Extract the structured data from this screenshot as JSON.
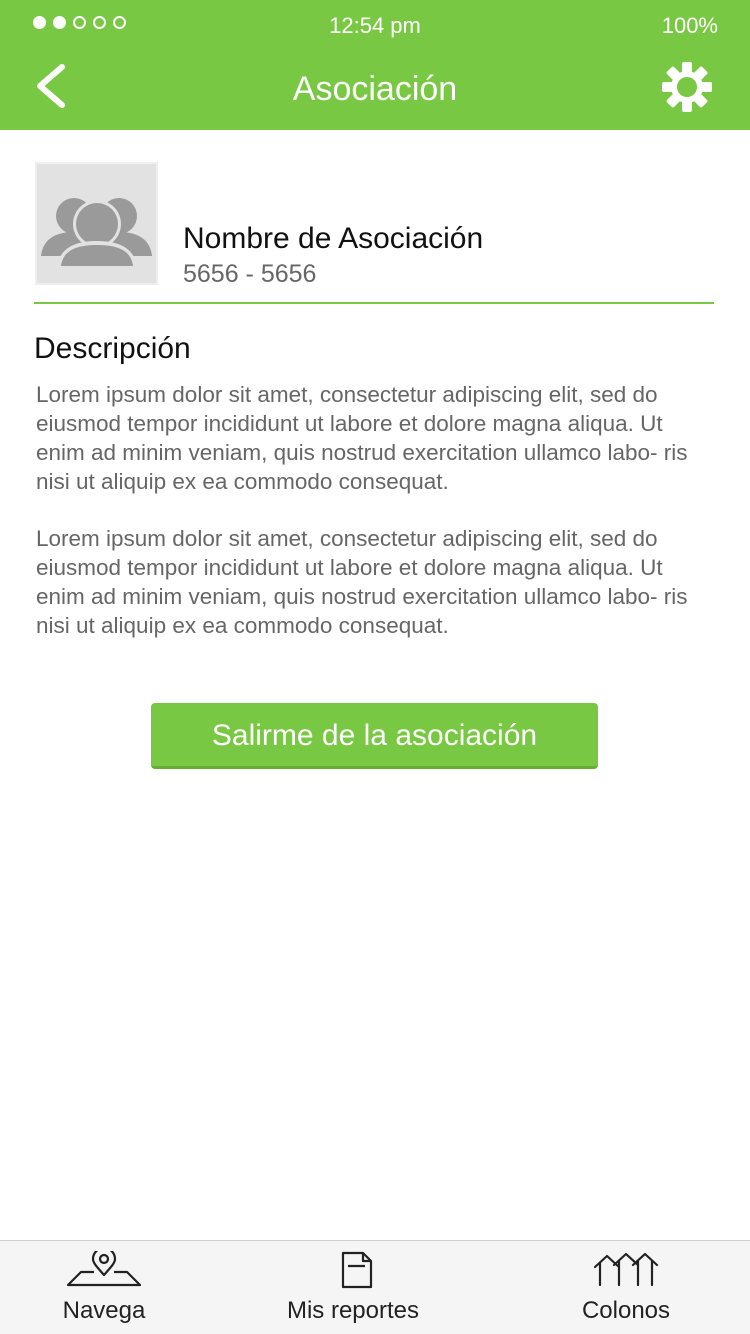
{
  "status_bar": {
    "time": "12:54 pm",
    "battery": "100%",
    "signal_bars_filled": 2,
    "signal_bars_total": 5
  },
  "nav": {
    "title": "Asociación",
    "back_icon": "chevron-left-icon",
    "settings_icon": "gear-icon"
  },
  "association": {
    "avatar_icon": "group-users-icon",
    "name": "Nombre de Asociación",
    "phone": "5656 - 5656"
  },
  "description": {
    "heading": "Descripción",
    "paragraphs": [
      "Lorem ipsum dolor sit amet, consectetur adipiscing elit, sed do eiusmod tempor incididunt ut labore et dolore magna aliqua. Ut enim ad minim veniam, quis nostrud exercitation ullamco labo- ris nisi ut aliquip ex ea commodo consequat.",
      "Lorem ipsum dolor sit amet, consectetur adipiscing elit, sed do eiusmod tempor incididunt ut labore et dolore magna aliqua. Ut enim ad minim veniam, quis nostrud exercitation ullamco labo- ris nisi ut aliquip ex ea commodo consequat."
    ]
  },
  "actions": {
    "leave_label": "Salirme de la asociación"
  },
  "tabbar": {
    "items": [
      {
        "label": "Navega",
        "icon": "map-pin-icon"
      },
      {
        "label": "Mis reportes",
        "icon": "document-icon"
      },
      {
        "label": "Colonos",
        "icon": "houses-icon"
      }
    ]
  },
  "colors": {
    "accent": "#79c843",
    "text_dark": "#111111",
    "text_muted": "#666666",
    "tabbar_bg": "#f5f5f5"
  }
}
